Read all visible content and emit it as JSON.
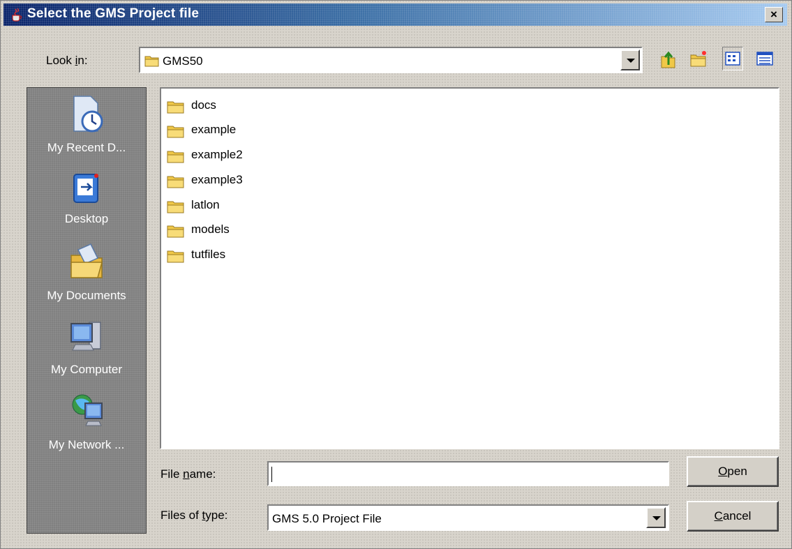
{
  "window": {
    "title": "Select the GMS Project file",
    "close_glyph": "×"
  },
  "lookin": {
    "label_pre": "Look ",
    "label_key": "i",
    "label_post": "n:",
    "value": "GMS50"
  },
  "toolbar": [
    {
      "name": "up-one-level-icon"
    },
    {
      "name": "create-new-folder-icon"
    },
    {
      "name": "list-view-icon",
      "pressed": true
    },
    {
      "name": "details-view-icon"
    }
  ],
  "places": [
    {
      "label": "My Recent D...",
      "icon": "recent-documents-icon"
    },
    {
      "label": "Desktop",
      "icon": "desktop-icon"
    },
    {
      "label": "My Documents",
      "icon": "my-documents-icon"
    },
    {
      "label": "My Computer",
      "icon": "my-computer-icon"
    },
    {
      "label": "My Network ...",
      "icon": "my-network-icon"
    }
  ],
  "files": [
    "docs",
    "example",
    "example2",
    "example3",
    "latlon",
    "models",
    "tutfiles"
  ],
  "filename": {
    "label_pre": "File ",
    "label_key": "n",
    "label_post": "ame:",
    "value": ""
  },
  "filetype": {
    "label_pre": "Files of ",
    "label_key": "t",
    "label_post": "ype:",
    "value": "GMS 5.0 Project File"
  },
  "buttons": {
    "open": {
      "key": "O",
      "rest": "pen"
    },
    "cancel": {
      "key": "C",
      "rest": "ancel"
    }
  },
  "colors": {
    "title_start": "#0a246a",
    "title_end": "#a6caf0",
    "places_bg": "#808080",
    "folder": "#f0c848"
  }
}
